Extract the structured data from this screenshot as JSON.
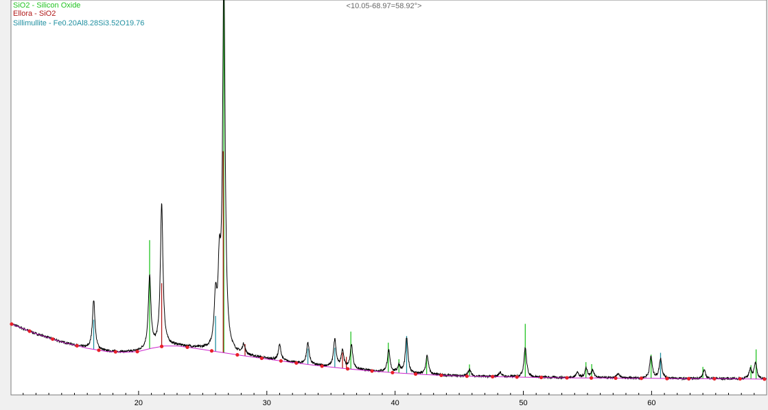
{
  "range_label": "<10.05-68.97=58.92°>",
  "legend": [
    {
      "label": "SiO2 - Silicon Oxide",
      "color": "#22c322"
    },
    {
      "label": "Ellora - SiO2",
      "color": "#b01818"
    },
    {
      "label": "Sillimullite - Fe0.20Al8.28Si3.52O19.76",
      "color": "#1f8fa0"
    }
  ],
  "colors": {
    "background": "#f0f0f0",
    "plot_background": "#ffffff",
    "pattern": "#000000",
    "background_curve": "#cc22cc",
    "background_points": "#e8202a"
  },
  "chart_data": {
    "type": "line",
    "title": "",
    "xlabel": "",
    "ylabel": "",
    "xlim": [
      10.05,
      68.97
    ],
    "ylim": [
      0,
      1
    ],
    "x_ticks": [
      20,
      30,
      40,
      50,
      60
    ],
    "grid": false,
    "legend_position": "top-left",
    "background": [
      [
        10.05,
        0.18
      ],
      [
        12,
        0.155
      ],
      [
        14,
        0.134
      ],
      [
        16,
        0.118
      ],
      [
        17.5,
        0.11
      ],
      [
        19,
        0.108
      ],
      [
        20,
        0.11
      ],
      [
        21,
        0.118
      ],
      [
        22,
        0.124
      ],
      [
        23,
        0.124
      ],
      [
        24,
        0.12
      ],
      [
        25,
        0.115
      ],
      [
        26,
        0.11
      ],
      [
        28,
        0.1
      ],
      [
        30,
        0.091
      ],
      [
        32,
        0.082
      ],
      [
        34,
        0.074
      ],
      [
        36,
        0.067
      ],
      [
        38,
        0.061
      ],
      [
        40,
        0.056
      ],
      [
        42,
        0.052
      ],
      [
        44,
        0.049
      ],
      [
        46,
        0.047
      ],
      [
        48,
        0.046
      ],
      [
        50,
        0.045
      ],
      [
        52,
        0.044
      ],
      [
        54,
        0.043
      ],
      [
        56,
        0.043
      ],
      [
        58,
        0.042
      ],
      [
        60,
        0.042
      ],
      [
        62,
        0.041
      ],
      [
        64,
        0.041
      ],
      [
        66,
        0.041
      ],
      [
        68.97,
        0.04
      ]
    ],
    "background_points_x": [
      10.1,
      11.5,
      13.3,
      15.2,
      16.9,
      18.2,
      19.9,
      21.8,
      23.8,
      25.7,
      27.7,
      29.6,
      31.1,
      32.3,
      34.3,
      36.3,
      38.2,
      39.8,
      41.6,
      43.6,
      45.6,
      47.6,
      49.5,
      51.4,
      53.4,
      55.3,
      57.2,
      59.2,
      61.2,
      62.9,
      64.9,
      66.9,
      68.8
    ],
    "peaks": [
      {
        "x": 16.5,
        "height": 0.125
      },
      {
        "x": 20.86,
        "height": 0.18
      },
      {
        "x": 21.8,
        "height": 0.36
      },
      {
        "x": 26.0,
        "height": 0.12
      },
      {
        "x": 26.3,
        "height": 0.18
      },
      {
        "x": 26.65,
        "height": 0.94
      },
      {
        "x": 28.2,
        "height": 0.025
      },
      {
        "x": 31.0,
        "height": 0.04
      },
      {
        "x": 33.2,
        "height": 0.055
      },
      {
        "x": 35.3,
        "height": 0.07
      },
      {
        "x": 35.9,
        "height": 0.045
      },
      {
        "x": 36.6,
        "height": 0.06
      },
      {
        "x": 39.5,
        "height": 0.055
      },
      {
        "x": 40.3,
        "height": 0.018
      },
      {
        "x": 40.9,
        "height": 0.09
      },
      {
        "x": 42.5,
        "height": 0.048
      },
      {
        "x": 45.8,
        "height": 0.018
      },
      {
        "x": 48.2,
        "height": 0.012
      },
      {
        "x": 50.15,
        "height": 0.075
      },
      {
        "x": 54.2,
        "height": 0.015
      },
      {
        "x": 54.9,
        "height": 0.025
      },
      {
        "x": 55.4,
        "height": 0.02
      },
      {
        "x": 57.4,
        "height": 0.012
      },
      {
        "x": 59.95,
        "height": 0.055
      },
      {
        "x": 60.7,
        "height": 0.05
      },
      {
        "x": 64.1,
        "height": 0.022
      },
      {
        "x": 67.7,
        "height": 0.025
      },
      {
        "x": 68.1,
        "height": 0.04
      }
    ],
    "reference_sticks": [
      {
        "phase": "SiO2 - Silicon Oxide",
        "color": "#22c322",
        "x": [
          20.86,
          26.65,
          36.55,
          39.47,
          40.3,
          42.46,
          45.8,
          50.15,
          54.88,
          55.33,
          59.96,
          64.0,
          67.75,
          68.15
        ],
        "heights": [
          0.275,
          0.985,
          0.095,
          0.075,
          0.035,
          0.045,
          0.03,
          0.135,
          0.04,
          0.035,
          0.06,
          0.03,
          0.035,
          0.075
        ]
      },
      {
        "phase": "Ellora - SiO2",
        "color": "#b01818",
        "x": [
          21.8,
          26.6,
          28.3,
          35.9,
          36.2
        ],
        "heights": [
          0.16,
          0.51,
          0.03,
          0.04,
          0.03
        ]
      },
      {
        "phase": "Sillimullite - Fe0.20Al8.28Si3.52O19.76",
        "color": "#1f8fa0",
        "x": [
          16.5,
          26.0,
          33.2,
          35.3,
          40.9,
          60.7
        ],
        "heights": [
          0.075,
          0.09,
          0.04,
          0.05,
          0.095,
          0.065
        ]
      }
    ]
  }
}
